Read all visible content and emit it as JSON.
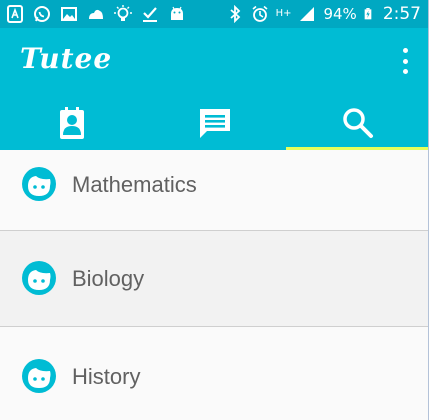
{
  "status_bar": {
    "battery": "94%",
    "time": "2:57",
    "network": "H+"
  },
  "app": {
    "title": "Tutee"
  },
  "tabs": [
    {
      "icon": "contact-icon",
      "active": false
    },
    {
      "icon": "message-icon",
      "active": false
    },
    {
      "icon": "search-icon",
      "active": true
    }
  ],
  "subjects": [
    {
      "label": "Mathematics"
    },
    {
      "label": "Biology"
    },
    {
      "label": "History"
    }
  ],
  "colors": {
    "app_bar": "#00bcd4",
    "status_bar": "#00a8c2",
    "tab_indicator": "#e6ff5c",
    "face_icon": "#00bcd4"
  }
}
